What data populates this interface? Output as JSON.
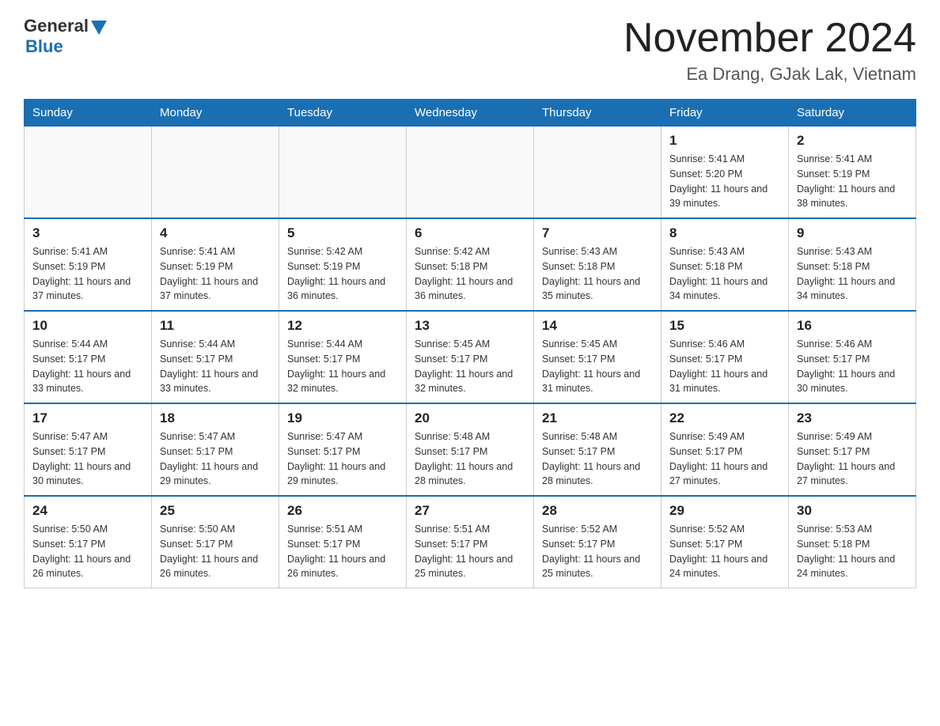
{
  "header": {
    "logo": {
      "general": "General",
      "triangle_color": "#1a6fb3",
      "blue": "Blue"
    },
    "title": "November 2024",
    "location": "Ea Drang, GJak Lak, Vietnam"
  },
  "calendar": {
    "days_of_week": [
      "Sunday",
      "Monday",
      "Tuesday",
      "Wednesday",
      "Thursday",
      "Friday",
      "Saturday"
    ],
    "weeks": [
      [
        {
          "day": "",
          "info": ""
        },
        {
          "day": "",
          "info": ""
        },
        {
          "day": "",
          "info": ""
        },
        {
          "day": "",
          "info": ""
        },
        {
          "day": "",
          "info": ""
        },
        {
          "day": "1",
          "info": "Sunrise: 5:41 AM\nSunset: 5:20 PM\nDaylight: 11 hours\nand 39 minutes."
        },
        {
          "day": "2",
          "info": "Sunrise: 5:41 AM\nSunset: 5:19 PM\nDaylight: 11 hours\nand 38 minutes."
        }
      ],
      [
        {
          "day": "3",
          "info": "Sunrise: 5:41 AM\nSunset: 5:19 PM\nDaylight: 11 hours\nand 37 minutes."
        },
        {
          "day": "4",
          "info": "Sunrise: 5:41 AM\nSunset: 5:19 PM\nDaylight: 11 hours\nand 37 minutes."
        },
        {
          "day": "5",
          "info": "Sunrise: 5:42 AM\nSunset: 5:19 PM\nDaylight: 11 hours\nand 36 minutes."
        },
        {
          "day": "6",
          "info": "Sunrise: 5:42 AM\nSunset: 5:18 PM\nDaylight: 11 hours\nand 36 minutes."
        },
        {
          "day": "7",
          "info": "Sunrise: 5:43 AM\nSunset: 5:18 PM\nDaylight: 11 hours\nand 35 minutes."
        },
        {
          "day": "8",
          "info": "Sunrise: 5:43 AM\nSunset: 5:18 PM\nDaylight: 11 hours\nand 34 minutes."
        },
        {
          "day": "9",
          "info": "Sunrise: 5:43 AM\nSunset: 5:18 PM\nDaylight: 11 hours\nand 34 minutes."
        }
      ],
      [
        {
          "day": "10",
          "info": "Sunrise: 5:44 AM\nSunset: 5:17 PM\nDaylight: 11 hours\nand 33 minutes."
        },
        {
          "day": "11",
          "info": "Sunrise: 5:44 AM\nSunset: 5:17 PM\nDaylight: 11 hours\nand 33 minutes."
        },
        {
          "day": "12",
          "info": "Sunrise: 5:44 AM\nSunset: 5:17 PM\nDaylight: 11 hours\nand 32 minutes."
        },
        {
          "day": "13",
          "info": "Sunrise: 5:45 AM\nSunset: 5:17 PM\nDaylight: 11 hours\nand 32 minutes."
        },
        {
          "day": "14",
          "info": "Sunrise: 5:45 AM\nSunset: 5:17 PM\nDaylight: 11 hours\nand 31 minutes."
        },
        {
          "day": "15",
          "info": "Sunrise: 5:46 AM\nSunset: 5:17 PM\nDaylight: 11 hours\nand 31 minutes."
        },
        {
          "day": "16",
          "info": "Sunrise: 5:46 AM\nSunset: 5:17 PM\nDaylight: 11 hours\nand 30 minutes."
        }
      ],
      [
        {
          "day": "17",
          "info": "Sunrise: 5:47 AM\nSunset: 5:17 PM\nDaylight: 11 hours\nand 30 minutes."
        },
        {
          "day": "18",
          "info": "Sunrise: 5:47 AM\nSunset: 5:17 PM\nDaylight: 11 hours\nand 29 minutes."
        },
        {
          "day": "19",
          "info": "Sunrise: 5:47 AM\nSunset: 5:17 PM\nDaylight: 11 hours\nand 29 minutes."
        },
        {
          "day": "20",
          "info": "Sunrise: 5:48 AM\nSunset: 5:17 PM\nDaylight: 11 hours\nand 28 minutes."
        },
        {
          "day": "21",
          "info": "Sunrise: 5:48 AM\nSunset: 5:17 PM\nDaylight: 11 hours\nand 28 minutes."
        },
        {
          "day": "22",
          "info": "Sunrise: 5:49 AM\nSunset: 5:17 PM\nDaylight: 11 hours\nand 27 minutes."
        },
        {
          "day": "23",
          "info": "Sunrise: 5:49 AM\nSunset: 5:17 PM\nDaylight: 11 hours\nand 27 minutes."
        }
      ],
      [
        {
          "day": "24",
          "info": "Sunrise: 5:50 AM\nSunset: 5:17 PM\nDaylight: 11 hours\nand 26 minutes."
        },
        {
          "day": "25",
          "info": "Sunrise: 5:50 AM\nSunset: 5:17 PM\nDaylight: 11 hours\nand 26 minutes."
        },
        {
          "day": "26",
          "info": "Sunrise: 5:51 AM\nSunset: 5:17 PM\nDaylight: 11 hours\nand 26 minutes."
        },
        {
          "day": "27",
          "info": "Sunrise: 5:51 AM\nSunset: 5:17 PM\nDaylight: 11 hours\nand 25 minutes."
        },
        {
          "day": "28",
          "info": "Sunrise: 5:52 AM\nSunset: 5:17 PM\nDaylight: 11 hours\nand 25 minutes."
        },
        {
          "day": "29",
          "info": "Sunrise: 5:52 AM\nSunset: 5:17 PM\nDaylight: 11 hours\nand 24 minutes."
        },
        {
          "day": "30",
          "info": "Sunrise: 5:53 AM\nSunset: 5:18 PM\nDaylight: 11 hours\nand 24 minutes."
        }
      ]
    ]
  }
}
